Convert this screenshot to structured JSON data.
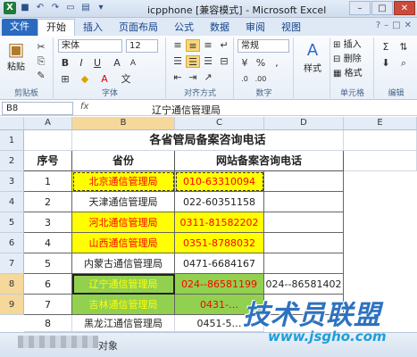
{
  "window": {
    "title": "icpphone [兼容模式] - Microsoft Excel",
    "file_icon": "excel-logo"
  },
  "quick_access": [
    "save-icon",
    "undo-icon",
    "redo-icon",
    "new-icon",
    "open-icon",
    "print-icon"
  ],
  "tabs": [
    "文件",
    "开始",
    "插入",
    "页面布局",
    "公式",
    "数据",
    "审阅",
    "视图"
  ],
  "active_tab": "开始",
  "ribbon": {
    "paste_label": "粘贴",
    "clipboard_label": "剪贴板",
    "font_name": "宋体",
    "font_size": "12",
    "font_label": "字体",
    "bold": "B",
    "italic": "I",
    "underline": "U",
    "align_label": "对齐方式",
    "number_format": "常规",
    "number_label": "数字",
    "style_label": "样式",
    "insert_label": "插入",
    "delete_label": "删除",
    "format_label": "格式",
    "cells_label": "单元格",
    "edit_label": "编辑",
    "percent": "%",
    "comma": ",",
    "currency": "¥"
  },
  "formula_bar": {
    "name_box": "B8",
    "fx": "fx",
    "content": "辽宁通信管理局"
  },
  "columns": [
    "A",
    "B",
    "C",
    "D",
    "E"
  ],
  "rows": [
    "1",
    "2",
    "3",
    "4",
    "5",
    "6",
    "7",
    "8",
    "9"
  ],
  "sheet": {
    "title": "各省管局备案咨询电话",
    "headers": {
      "seq": "序号",
      "province": "省份",
      "phone": "网站备案咨询电话"
    },
    "data": [
      {
        "seq": "1",
        "name": "北京通信管理局",
        "phone": "010-63310094",
        "d": ""
      },
      {
        "seq": "2",
        "name": "天津通信管理局",
        "phone": "022-60351158",
        "d": ""
      },
      {
        "seq": "3",
        "name": "河北通信管理局",
        "phone": "0311-81582202",
        "d": ""
      },
      {
        "seq": "4",
        "name": "山西通信管理局",
        "phone": "0351-8788032",
        "d": ""
      },
      {
        "seq": "5",
        "name": "内蒙古通信管理局",
        "phone": "0471-6684167",
        "d": ""
      },
      {
        "seq": "6",
        "name": "辽宁通信管理局",
        "phone": "024--86581199",
        "d": "024--86581402"
      },
      {
        "seq": "7",
        "name": "吉林通信管理局",
        "phone": "0431-…",
        "d": ""
      },
      {
        "seq": "8",
        "name": "黑龙江通信管理局",
        "phone": "0451-5…",
        "d": ""
      }
    ]
  },
  "sheet_tab_label": "对象",
  "watermark": {
    "main": "技术员联盟",
    "url": "www.jsgho.com"
  },
  "colors": {
    "yellow": "#ffff00",
    "green": "#92d050",
    "red_text": "#ff0000"
  }
}
